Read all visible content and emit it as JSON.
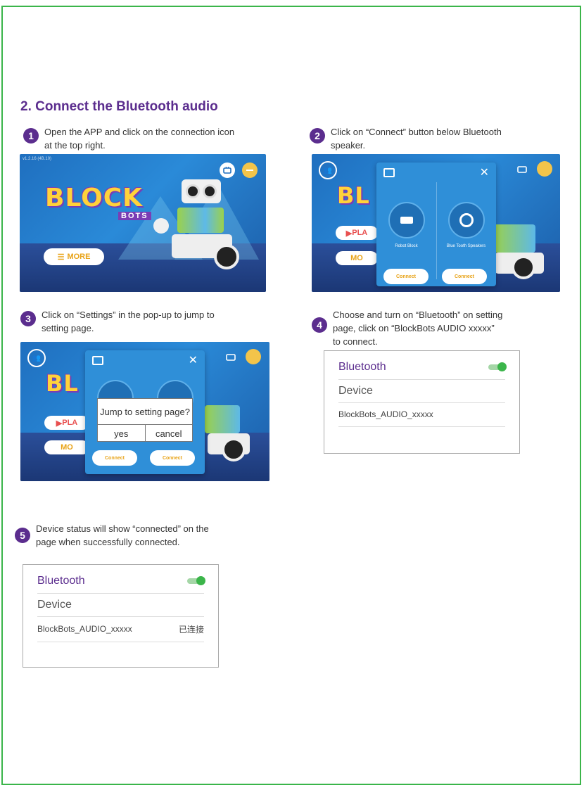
{
  "section_title": "2. Connect the Bluetooth audio",
  "colors": {
    "brand_purple": "#5b2d8e",
    "border_green": "#3bb54a",
    "app_blue": "#2a8ad8",
    "accent_orange": "#e8a318"
  },
  "steps": [
    {
      "number": "1",
      "text_line1": "Open the APP and click on the connection icon",
      "text_line2": "at the top right."
    },
    {
      "number": "2",
      "text_line1": "Click on “Connect” button below Bluetooth",
      "text_line2": "speaker."
    },
    {
      "number": "3",
      "text_line1": "Click on “Settings” in the pop-up to jump to",
      "text_line2": "setting page."
    },
    {
      "number": "4",
      "text_line1": "Choose and turn on “Bluetooth” on setting",
      "text_line2": "page, click on “BlockBots AUDIO xxxxx”",
      "text_line3": "to connect."
    },
    {
      "number": "5",
      "text_line1": "Device status will show “connected” on the",
      "text_line2": "page when successfully connected."
    }
  ],
  "app": {
    "version": "v1.2.16 (4B.10)",
    "logo_main": "BLOCK",
    "logo_sub": "BOTS",
    "more_label": "MORE",
    "play_label": "PLA",
    "more_partial": "MO",
    "dialog": {
      "left_device": "Robot Block",
      "right_device": "Blue Tooth Speakers",
      "connect_label": "Connect"
    },
    "popup": {
      "question": "Jump to setting page?",
      "yes": "yes",
      "cancel": "cancel"
    }
  },
  "settings_panel_a": {
    "bluetooth_label": "Bluetooth",
    "bluetooth_on": true,
    "device_label": "Device",
    "item_name": "BlockBots_AUDIO_xxxxx"
  },
  "settings_panel_b": {
    "bluetooth_label": "Bluetooth",
    "bluetooth_on": true,
    "device_label": "Device",
    "item_name": "BlockBots_AUDIO_xxxxx",
    "item_status": "已连接"
  }
}
